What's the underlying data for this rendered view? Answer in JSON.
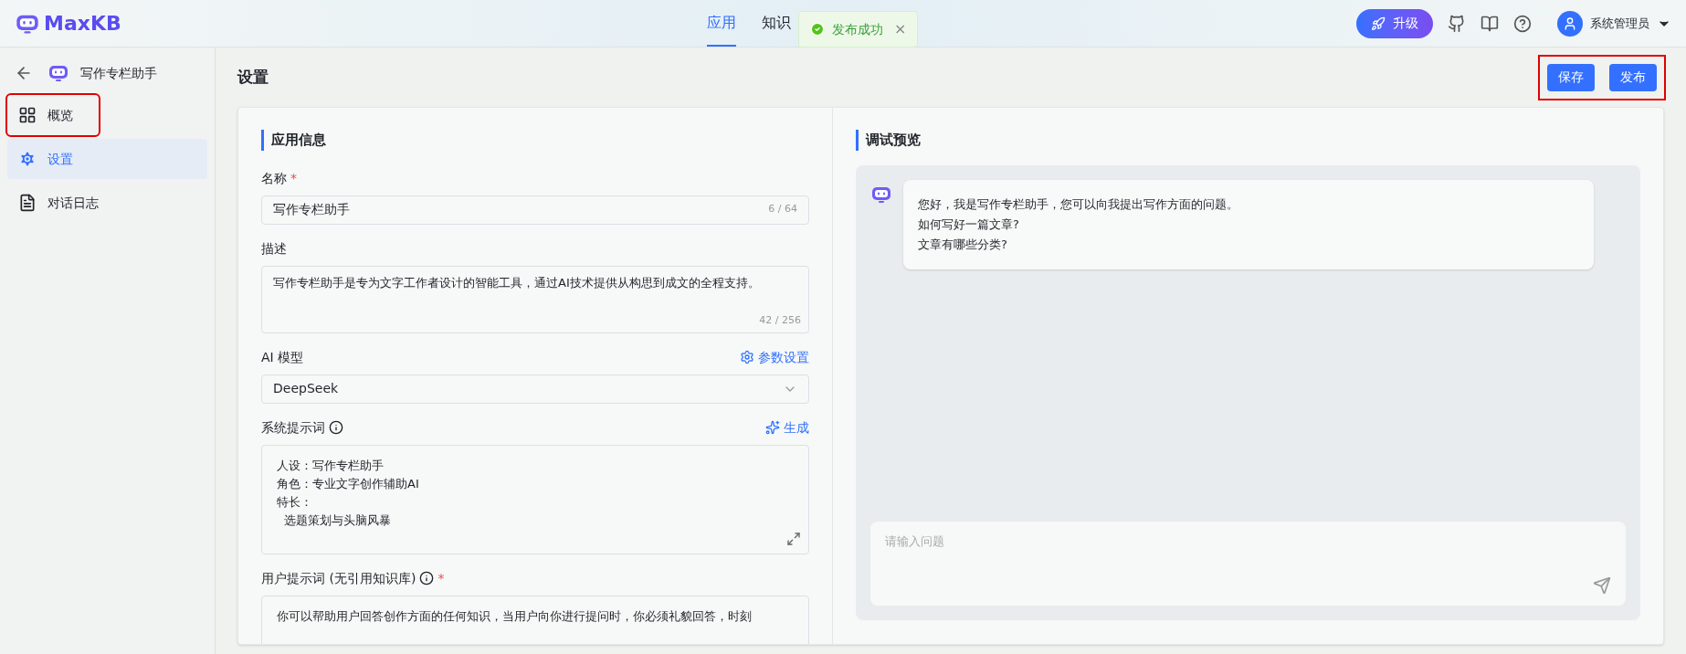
{
  "header": {
    "logo": "MaxKB",
    "nav": [
      {
        "label": "应用",
        "selected": true
      },
      {
        "label": "知识",
        "selected": false
      }
    ],
    "toast": {
      "text": "发布成功",
      "close": "×"
    },
    "upgrade": "升级",
    "user": "系统管理员"
  },
  "sidebar": {
    "app_name": "写作专栏助手",
    "items": [
      {
        "label": "概览",
        "selected": false,
        "highlighted": true
      },
      {
        "label": "设置",
        "selected": true,
        "highlighted": false
      },
      {
        "label": "对话日志",
        "selected": false,
        "highlighted": false
      }
    ]
  },
  "page": {
    "title": "设置",
    "buttons": [
      "保存",
      "发布"
    ],
    "buttons_highlighted": true
  },
  "app_info": {
    "title": "应用信息",
    "required_mark": "*",
    "name_label": "名称",
    "name_value": "写作专栏助手",
    "name_count": "6 / 64",
    "desc_label": "描述",
    "desc_value": "写作专栏助手是专为文字工作者设计的智能工具，通过AI技术提供从构思到成文的全程支持。",
    "desc_count": "42 / 256",
    "model_label": "AI 模型",
    "model_link": "参数设置",
    "model_value": "DeepSeek",
    "system_label": "系统提示词",
    "system_link": "生成",
    "system_lines": [
      "人设：写作专栏助手",
      "角色：专业文字创作辅助AI",
      "特长：",
      "  选题策划与头脑风暴"
    ],
    "user_label": "用户提示词 (无引用知识库)",
    "user_lines": [
      "你可以帮助用户回答创作方面的任何知识，当用户向你进行提问时，你必须礼貌回答，时刻"
    ]
  },
  "preview": {
    "title": "调试预览",
    "messages": [
      "您好，我是写作专栏助手，您可以向我提出写作方面的问题。",
      "如何写好一篇文章?",
      "文章有哪些分类?"
    ],
    "input_placeholder": "请输入问题"
  }
}
